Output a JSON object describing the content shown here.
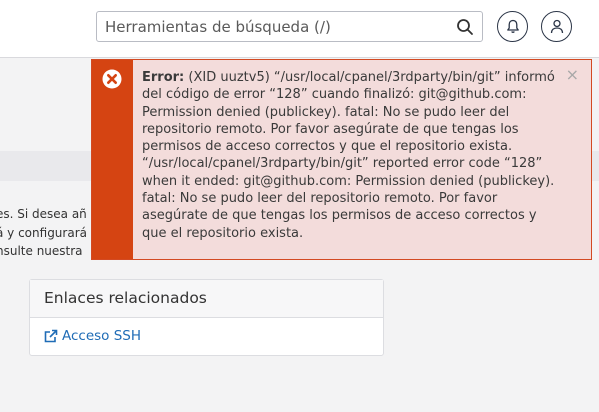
{
  "search": {
    "placeholder": "Herramientas de búsqueda (/)"
  },
  "background_text": {
    "line1": "es. Si desea añ",
    "line2": "á y configurará",
    "line3": "nsulte nuestra"
  },
  "related_links": {
    "title": "Enlaces relacionados",
    "ssh_link": "Acceso SSH"
  },
  "alert": {
    "label": "Error:",
    "message": "(XID uuztv5) “/usr/local/cpanel/3rdparty/bin/git” informó del código de error “128” cuando finalizó: git@github.com: Permission denied (publickey). fatal: No se pudo leer del repositorio remoto. Por favor asegúrate de que tengas los permisos de acceso correctos y que el repositorio exista. “/usr/local/cpanel/3rdparty/bin/git” reported error code “128” when it ended: git@github.com: Permission denied (publickey). fatal: No se pudo leer del repositorio remoto. Por favor asegúrate de que tengas los permisos de acceso correctos y que el repositorio exista.",
    "close": "×",
    "accent_color": "#d54412",
    "background_color": "#f3dcdb"
  },
  "icons": {
    "search": "search-icon",
    "notifications": "bell-icon",
    "user": "user-icon",
    "error": "error-icon",
    "external_link": "external-link-icon"
  }
}
